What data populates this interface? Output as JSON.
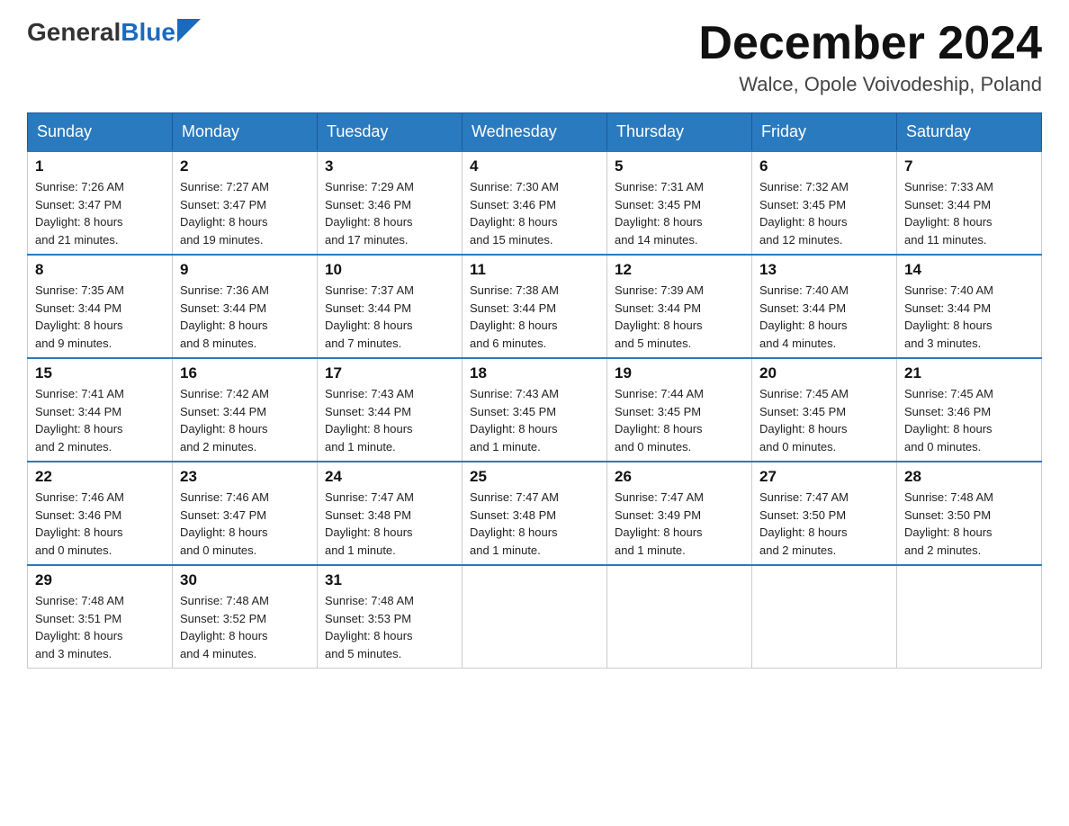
{
  "header": {
    "logo_general": "General",
    "logo_blue": "Blue",
    "month_title": "December 2024",
    "location": "Walce, Opole Voivodeship, Poland"
  },
  "weekdays": [
    "Sunday",
    "Monday",
    "Tuesday",
    "Wednesday",
    "Thursday",
    "Friday",
    "Saturday"
  ],
  "weeks": [
    [
      {
        "day": "1",
        "sunrise": "7:26 AM",
        "sunset": "3:47 PM",
        "daylight": "8 hours and 21 minutes."
      },
      {
        "day": "2",
        "sunrise": "7:27 AM",
        "sunset": "3:47 PM",
        "daylight": "8 hours and 19 minutes."
      },
      {
        "day": "3",
        "sunrise": "7:29 AM",
        "sunset": "3:46 PM",
        "daylight": "8 hours and 17 minutes."
      },
      {
        "day": "4",
        "sunrise": "7:30 AM",
        "sunset": "3:46 PM",
        "daylight": "8 hours and 15 minutes."
      },
      {
        "day": "5",
        "sunrise": "7:31 AM",
        "sunset": "3:45 PM",
        "daylight": "8 hours and 14 minutes."
      },
      {
        "day": "6",
        "sunrise": "7:32 AM",
        "sunset": "3:45 PM",
        "daylight": "8 hours and 12 minutes."
      },
      {
        "day": "7",
        "sunrise": "7:33 AM",
        "sunset": "3:44 PM",
        "daylight": "8 hours and 11 minutes."
      }
    ],
    [
      {
        "day": "8",
        "sunrise": "7:35 AM",
        "sunset": "3:44 PM",
        "daylight": "8 hours and 9 minutes."
      },
      {
        "day": "9",
        "sunrise": "7:36 AM",
        "sunset": "3:44 PM",
        "daylight": "8 hours and 8 minutes."
      },
      {
        "day": "10",
        "sunrise": "7:37 AM",
        "sunset": "3:44 PM",
        "daylight": "8 hours and 7 minutes."
      },
      {
        "day": "11",
        "sunrise": "7:38 AM",
        "sunset": "3:44 PM",
        "daylight": "8 hours and 6 minutes."
      },
      {
        "day": "12",
        "sunrise": "7:39 AM",
        "sunset": "3:44 PM",
        "daylight": "8 hours and 5 minutes."
      },
      {
        "day": "13",
        "sunrise": "7:40 AM",
        "sunset": "3:44 PM",
        "daylight": "8 hours and 4 minutes."
      },
      {
        "day": "14",
        "sunrise": "7:40 AM",
        "sunset": "3:44 PM",
        "daylight": "8 hours and 3 minutes."
      }
    ],
    [
      {
        "day": "15",
        "sunrise": "7:41 AM",
        "sunset": "3:44 PM",
        "daylight": "8 hours and 2 minutes."
      },
      {
        "day": "16",
        "sunrise": "7:42 AM",
        "sunset": "3:44 PM",
        "daylight": "8 hours and 2 minutes."
      },
      {
        "day": "17",
        "sunrise": "7:43 AM",
        "sunset": "3:44 PM",
        "daylight": "8 hours and 1 minute."
      },
      {
        "day": "18",
        "sunrise": "7:43 AM",
        "sunset": "3:45 PM",
        "daylight": "8 hours and 1 minute."
      },
      {
        "day": "19",
        "sunrise": "7:44 AM",
        "sunset": "3:45 PM",
        "daylight": "8 hours and 0 minutes."
      },
      {
        "day": "20",
        "sunrise": "7:45 AM",
        "sunset": "3:45 PM",
        "daylight": "8 hours and 0 minutes."
      },
      {
        "day": "21",
        "sunrise": "7:45 AM",
        "sunset": "3:46 PM",
        "daylight": "8 hours and 0 minutes."
      }
    ],
    [
      {
        "day": "22",
        "sunrise": "7:46 AM",
        "sunset": "3:46 PM",
        "daylight": "8 hours and 0 minutes."
      },
      {
        "day": "23",
        "sunrise": "7:46 AM",
        "sunset": "3:47 PM",
        "daylight": "8 hours and 0 minutes."
      },
      {
        "day": "24",
        "sunrise": "7:47 AM",
        "sunset": "3:48 PM",
        "daylight": "8 hours and 1 minute."
      },
      {
        "day": "25",
        "sunrise": "7:47 AM",
        "sunset": "3:48 PM",
        "daylight": "8 hours and 1 minute."
      },
      {
        "day": "26",
        "sunrise": "7:47 AM",
        "sunset": "3:49 PM",
        "daylight": "8 hours and 1 minute."
      },
      {
        "day": "27",
        "sunrise": "7:47 AM",
        "sunset": "3:50 PM",
        "daylight": "8 hours and 2 minutes."
      },
      {
        "day": "28",
        "sunrise": "7:48 AM",
        "sunset": "3:50 PM",
        "daylight": "8 hours and 2 minutes."
      }
    ],
    [
      {
        "day": "29",
        "sunrise": "7:48 AM",
        "sunset": "3:51 PM",
        "daylight": "8 hours and 3 minutes."
      },
      {
        "day": "30",
        "sunrise": "7:48 AM",
        "sunset": "3:52 PM",
        "daylight": "8 hours and 4 minutes."
      },
      {
        "day": "31",
        "sunrise": "7:48 AM",
        "sunset": "3:53 PM",
        "daylight": "8 hours and 5 minutes."
      },
      null,
      null,
      null,
      null
    ]
  ],
  "labels": {
    "sunrise_prefix": "Sunrise: ",
    "sunset_prefix": "Sunset: ",
    "daylight_prefix": "Daylight: "
  }
}
